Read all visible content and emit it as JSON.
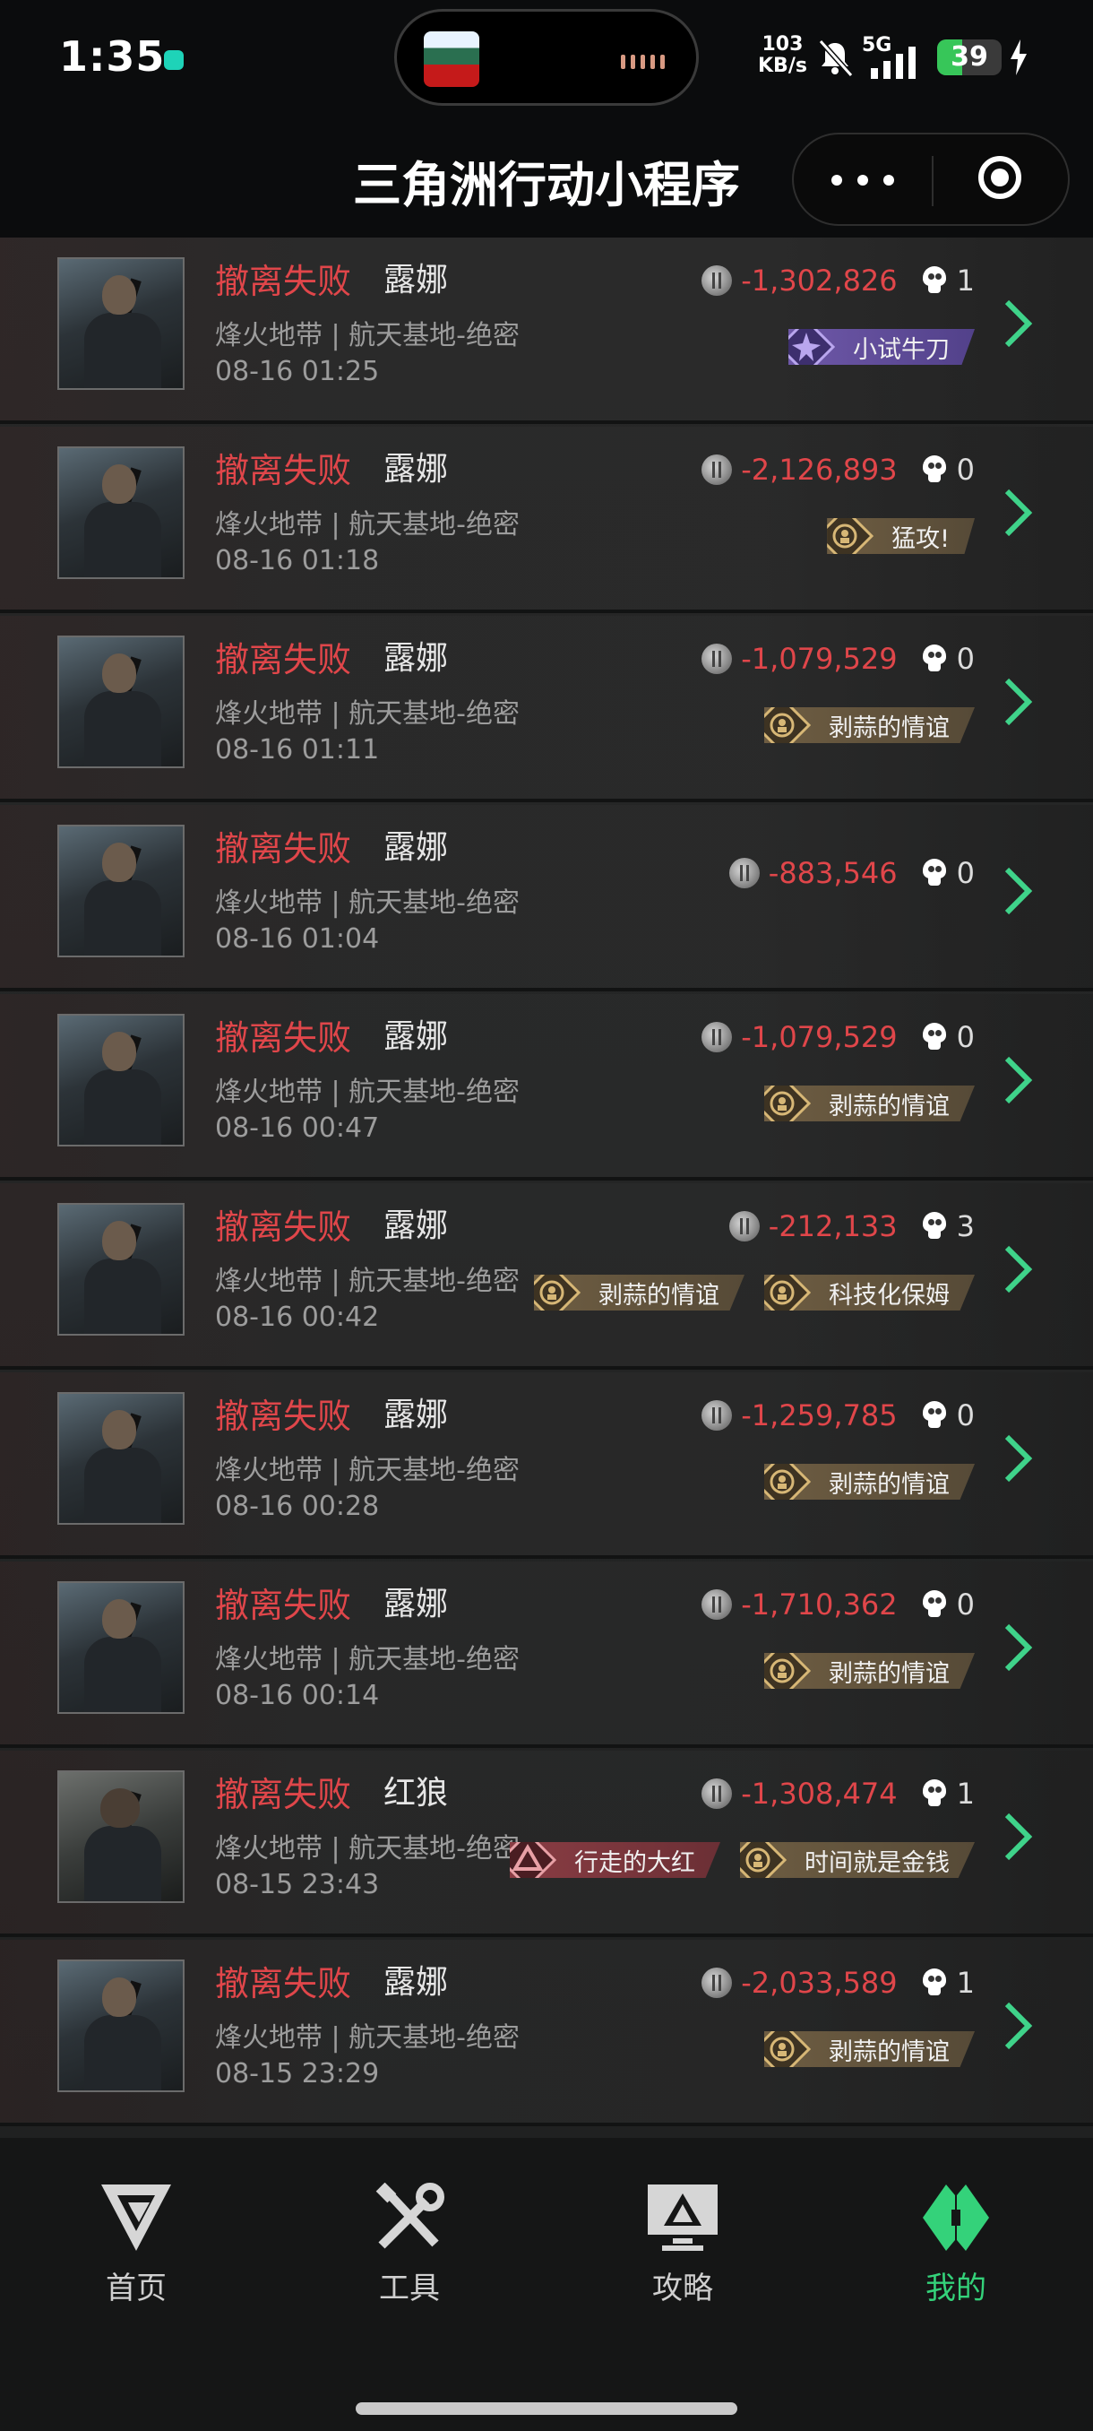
{
  "status_bar": {
    "time": "1:35",
    "net_speed_value": "103",
    "net_speed_unit": "KB/s",
    "network": "5G",
    "battery": "39",
    "battery_level": 0.39,
    "accent_color": "#37c659"
  },
  "nav": {
    "title": "三角洲行动小程序",
    "more_icon": "more-dots-icon",
    "close_icon": "target-circle-icon"
  },
  "records": [
    {
      "status": "撤离失败",
      "operator": "露娜",
      "map": "烽火地带 | 航天基地-绝密",
      "time": "08-16 01:25",
      "value": "-1,302,826",
      "kills": "1",
      "badges": [
        {
          "label": "小试牛刀",
          "color": "purple",
          "icon": "spark-icon"
        }
      ]
    },
    {
      "status": "撤离失败",
      "operator": "露娜",
      "map": "烽火地带 | 航天基地-绝密",
      "time": "08-16 01:18",
      "value": "-2,126,893",
      "kills": "0",
      "badges": [
        {
          "label": "猛攻!",
          "color": "gold",
          "icon": "soldier-emblem-icon"
        }
      ]
    },
    {
      "status": "撤离失败",
      "operator": "露娜",
      "map": "烽火地带 | 航天基地-绝密",
      "time": "08-16 01:11",
      "value": "-1,079,529",
      "kills": "0",
      "badges": [
        {
          "label": "剥蒜的情谊",
          "color": "gold",
          "icon": "soldier-emblem-icon"
        }
      ]
    },
    {
      "status": "撤离失败",
      "operator": "露娜",
      "map": "烽火地带 | 航天基地-绝密",
      "time": "08-16 01:04",
      "value": "-883,546",
      "kills": "0",
      "badges": []
    },
    {
      "status": "撤离失败",
      "operator": "露娜",
      "map": "烽火地带 | 航天基地-绝密",
      "time": "08-16 00:47",
      "value": "-1,079,529",
      "kills": "0",
      "badges": [
        {
          "label": "剥蒜的情谊",
          "color": "gold",
          "icon": "soldier-emblem-icon"
        }
      ]
    },
    {
      "status": "撤离失败",
      "operator": "露娜",
      "map": "烽火地带 | 航天基地-绝密",
      "time": "08-16 00:42",
      "value": "-212,133",
      "kills": "3",
      "badges": [
        {
          "label": "剥蒜的情谊",
          "color": "gold",
          "icon": "soldier-emblem-icon"
        },
        {
          "label": "科技化保姆",
          "color": "gold",
          "icon": "soldier-emblem-icon"
        }
      ]
    },
    {
      "status": "撤离失败",
      "operator": "露娜",
      "map": "烽火地带 | 航天基地-绝密",
      "time": "08-16 00:28",
      "value": "-1,259,785",
      "kills": "0",
      "badges": [
        {
          "label": "剥蒜的情谊",
          "color": "gold",
          "icon": "soldier-emblem-icon"
        }
      ]
    },
    {
      "status": "撤离失败",
      "operator": "露娜",
      "map": "烽火地带 | 航天基地-绝密",
      "time": "08-16 00:14",
      "value": "-1,710,362",
      "kills": "0",
      "badges": [
        {
          "label": "剥蒜的情谊",
          "color": "gold",
          "icon": "soldier-emblem-icon"
        }
      ]
    },
    {
      "status": "撤离失败",
      "operator": "红狼",
      "map": "烽火地带 | 航天基地-绝密",
      "time": "08-15 23:43",
      "value": "-1,308,474",
      "kills": "1",
      "badges": [
        {
          "label": "行走的大红",
          "color": "red",
          "icon": "triangle-emblem-icon"
        },
        {
          "label": "时间就是金钱",
          "color": "gold",
          "icon": "soldier-emblem-icon"
        }
      ]
    },
    {
      "status": "撤离失败",
      "operator": "露娜",
      "map": "烽火地带 | 航天基地-绝密",
      "time": "08-15 23:29",
      "value": "-2,033,589",
      "kills": "1",
      "badges": [
        {
          "label": "剥蒜的情谊",
          "color": "gold",
          "icon": "soldier-emblem-icon"
        }
      ]
    }
  ],
  "tabs": [
    {
      "label": "首页",
      "icon": "home-logo-icon"
    },
    {
      "label": "工具",
      "icon": "tools-icon"
    },
    {
      "label": "攻略",
      "icon": "guide-monitor-icon"
    },
    {
      "label": "我的",
      "icon": "profile-logo-icon"
    }
  ],
  "colors": {
    "loss_red": "#e0464a",
    "active_tab": "#34d27a",
    "chevron": "#3fd38a"
  }
}
